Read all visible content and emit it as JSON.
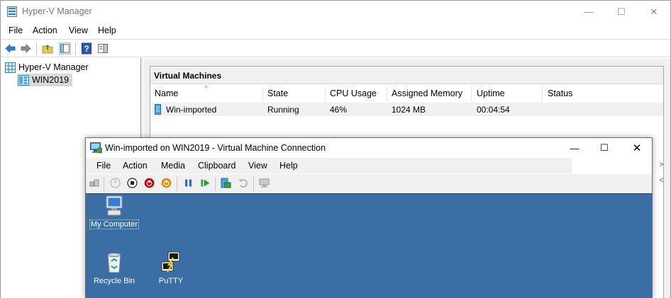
{
  "hv": {
    "title": "Hyper-V Manager",
    "controls": {
      "minimize": "—",
      "maximize": "☐",
      "close": "✕"
    },
    "menu": [
      "File",
      "Action",
      "View",
      "Help"
    ],
    "toolbar_icons": [
      "back-arrow-icon",
      "forward-arrow-icon",
      "folder-up-icon",
      "show-hide-console-tree-icon",
      "help-icon",
      "show-hide-action-pane-icon"
    ],
    "tree": {
      "root": "Hyper-V Manager",
      "server": "WIN2019"
    },
    "vm_pane": {
      "header": "Virtual Machines",
      "columns": [
        "Name",
        "State",
        "CPU Usage",
        "Assigned Memory",
        "Uptime",
        "Status"
      ],
      "sort_indicator": "^",
      "rows": [
        {
          "name": "Win-imported",
          "state": "Running",
          "cpu": "46%",
          "memory": "1024 MB",
          "uptime": "00:04:54",
          "status": ""
        }
      ]
    },
    "side_scroll": {
      "right": ">",
      "left": "<"
    }
  },
  "vmc": {
    "title": "Win-imported on WIN2019 - Virtual Machine Connection",
    "controls": {
      "minimize": "—",
      "maximize": "☐",
      "close": "✕"
    },
    "menu": [
      "File",
      "Action",
      "Media",
      "Clipboard",
      "View",
      "Help"
    ],
    "toolbar_icons": [
      "ctrl-alt-del-icon",
      "start-icon",
      "turn-off-icon",
      "shutdown-icon",
      "save-state-icon",
      "pause-icon",
      "resume-icon",
      "checkpoint-icon",
      "revert-icon",
      "enhanced-session-icon"
    ],
    "desktop_bg": "#3a6ea5",
    "desktop": {
      "my_computer": "My Computer",
      "recycle_bin": "Recycle Bin",
      "putty": "PuTTY"
    }
  },
  "colors": {
    "accent_blue": "#1e78c8",
    "stop_red": "#cc0000",
    "shutdown_orange": "#e08a00",
    "pause_blue": "#1a73c9",
    "resume_green": "#1fa02f"
  }
}
